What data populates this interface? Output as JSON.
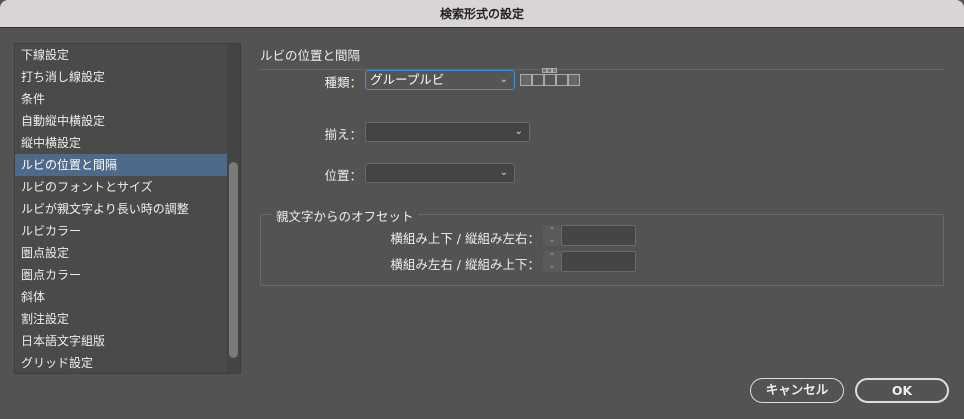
{
  "window": {
    "title": "検索形式の設定"
  },
  "sidebar": {
    "items": [
      {
        "label": "下線設定"
      },
      {
        "label": "打ち消し線設定"
      },
      {
        "label": "条件"
      },
      {
        "label": "自動縦中横設定"
      },
      {
        "label": "縦中横設定"
      },
      {
        "label": "ルビの位置と間隔",
        "selected": true
      },
      {
        "label": "ルビのフォントとサイズ"
      },
      {
        "label": "ルビが親文字より長い時の調整"
      },
      {
        "label": "ルビカラー"
      },
      {
        "label": "圏点設定"
      },
      {
        "label": "圏点カラー"
      },
      {
        "label": "斜体"
      },
      {
        "label": "割注設定"
      },
      {
        "label": "日本語文字組版"
      },
      {
        "label": "グリッド設定"
      }
    ]
  },
  "main": {
    "heading": "ルビの位置と間隔",
    "type_label": "種類：",
    "type_value": "グループルビ",
    "align_label": "揃え：",
    "align_value": "",
    "position_label": "位置：",
    "position_value": "",
    "offset": {
      "legend": "親文字からのオフセット",
      "row1_label": "横組み上下 / 縦組み左右：",
      "row1_value": "",
      "row2_label": "横組み左右 / 縦組み上下：",
      "row2_value": ""
    }
  },
  "buttons": {
    "cancel": "キャンセル",
    "ok": "OK"
  }
}
